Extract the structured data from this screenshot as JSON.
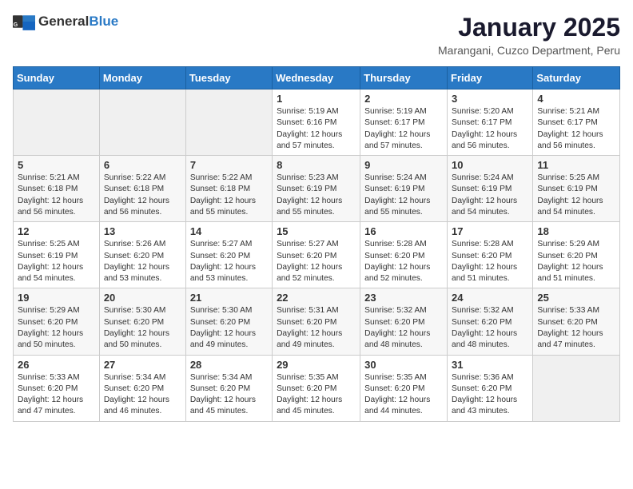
{
  "header": {
    "logo_general": "General",
    "logo_blue": "Blue",
    "month_title": "January 2025",
    "subtitle": "Marangani, Cuzco Department, Peru"
  },
  "weekdays": [
    "Sunday",
    "Monday",
    "Tuesday",
    "Wednesday",
    "Thursday",
    "Friday",
    "Saturday"
  ],
  "weeks": [
    [
      {
        "day": "",
        "empty": true
      },
      {
        "day": "",
        "empty": true
      },
      {
        "day": "",
        "empty": true
      },
      {
        "day": "1",
        "sunrise": "5:19 AM",
        "sunset": "6:16 PM",
        "daylight": "12 hours and 57 minutes."
      },
      {
        "day": "2",
        "sunrise": "5:19 AM",
        "sunset": "6:17 PM",
        "daylight": "12 hours and 57 minutes."
      },
      {
        "day": "3",
        "sunrise": "5:20 AM",
        "sunset": "6:17 PM",
        "daylight": "12 hours and 56 minutes."
      },
      {
        "day": "4",
        "sunrise": "5:21 AM",
        "sunset": "6:17 PM",
        "daylight": "12 hours and 56 minutes."
      }
    ],
    [
      {
        "day": "5",
        "sunrise": "5:21 AM",
        "sunset": "6:18 PM",
        "daylight": "12 hours and 56 minutes."
      },
      {
        "day": "6",
        "sunrise": "5:22 AM",
        "sunset": "6:18 PM",
        "daylight": "12 hours and 56 minutes."
      },
      {
        "day": "7",
        "sunrise": "5:22 AM",
        "sunset": "6:18 PM",
        "daylight": "12 hours and 55 minutes."
      },
      {
        "day": "8",
        "sunrise": "5:23 AM",
        "sunset": "6:19 PM",
        "daylight": "12 hours and 55 minutes."
      },
      {
        "day": "9",
        "sunrise": "5:24 AM",
        "sunset": "6:19 PM",
        "daylight": "12 hours and 55 minutes."
      },
      {
        "day": "10",
        "sunrise": "5:24 AM",
        "sunset": "6:19 PM",
        "daylight": "12 hours and 54 minutes."
      },
      {
        "day": "11",
        "sunrise": "5:25 AM",
        "sunset": "6:19 PM",
        "daylight": "12 hours and 54 minutes."
      }
    ],
    [
      {
        "day": "12",
        "sunrise": "5:25 AM",
        "sunset": "6:19 PM",
        "daylight": "12 hours and 54 minutes."
      },
      {
        "day": "13",
        "sunrise": "5:26 AM",
        "sunset": "6:20 PM",
        "daylight": "12 hours and 53 minutes."
      },
      {
        "day": "14",
        "sunrise": "5:27 AM",
        "sunset": "6:20 PM",
        "daylight": "12 hours and 53 minutes."
      },
      {
        "day": "15",
        "sunrise": "5:27 AM",
        "sunset": "6:20 PM",
        "daylight": "12 hours and 52 minutes."
      },
      {
        "day": "16",
        "sunrise": "5:28 AM",
        "sunset": "6:20 PM",
        "daylight": "12 hours and 52 minutes."
      },
      {
        "day": "17",
        "sunrise": "5:28 AM",
        "sunset": "6:20 PM",
        "daylight": "12 hours and 51 minutes."
      },
      {
        "day": "18",
        "sunrise": "5:29 AM",
        "sunset": "6:20 PM",
        "daylight": "12 hours and 51 minutes."
      }
    ],
    [
      {
        "day": "19",
        "sunrise": "5:29 AM",
        "sunset": "6:20 PM",
        "daylight": "12 hours and 50 minutes."
      },
      {
        "day": "20",
        "sunrise": "5:30 AM",
        "sunset": "6:20 PM",
        "daylight": "12 hours and 50 minutes."
      },
      {
        "day": "21",
        "sunrise": "5:30 AM",
        "sunset": "6:20 PM",
        "daylight": "12 hours and 49 minutes."
      },
      {
        "day": "22",
        "sunrise": "5:31 AM",
        "sunset": "6:20 PM",
        "daylight": "12 hours and 49 minutes."
      },
      {
        "day": "23",
        "sunrise": "5:32 AM",
        "sunset": "6:20 PM",
        "daylight": "12 hours and 48 minutes."
      },
      {
        "day": "24",
        "sunrise": "5:32 AM",
        "sunset": "6:20 PM",
        "daylight": "12 hours and 48 minutes."
      },
      {
        "day": "25",
        "sunrise": "5:33 AM",
        "sunset": "6:20 PM",
        "daylight": "12 hours and 47 minutes."
      }
    ],
    [
      {
        "day": "26",
        "sunrise": "5:33 AM",
        "sunset": "6:20 PM",
        "daylight": "12 hours and 47 minutes."
      },
      {
        "day": "27",
        "sunrise": "5:34 AM",
        "sunset": "6:20 PM",
        "daylight": "12 hours and 46 minutes."
      },
      {
        "day": "28",
        "sunrise": "5:34 AM",
        "sunset": "6:20 PM",
        "daylight": "12 hours and 45 minutes."
      },
      {
        "day": "29",
        "sunrise": "5:35 AM",
        "sunset": "6:20 PM",
        "daylight": "12 hours and 45 minutes."
      },
      {
        "day": "30",
        "sunrise": "5:35 AM",
        "sunset": "6:20 PM",
        "daylight": "12 hours and 44 minutes."
      },
      {
        "day": "31",
        "sunrise": "5:36 AM",
        "sunset": "6:20 PM",
        "daylight": "12 hours and 43 minutes."
      },
      {
        "day": "",
        "empty": true
      }
    ]
  ]
}
